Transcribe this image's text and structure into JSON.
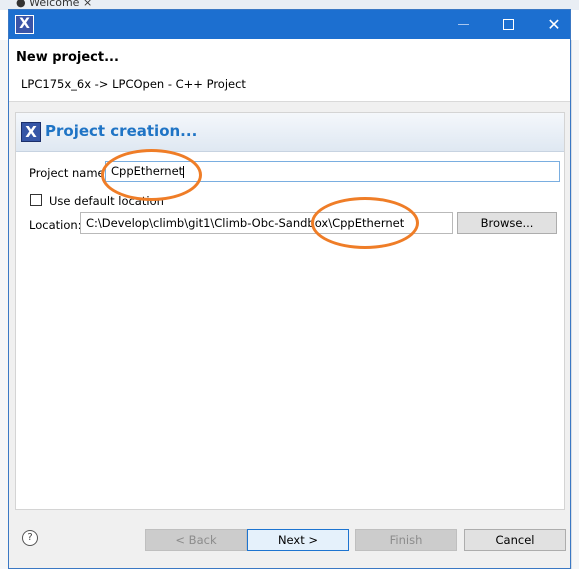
{
  "background": {
    "tab_label": "Welcome",
    "tab_close": "×"
  },
  "window": {
    "minimize_icon": "minimize-icon",
    "maximize_icon": "maximize-icon",
    "close_symbol": "✕"
  },
  "header": {
    "title": "New project...",
    "subtitle": "LPC175x_6x -> LPCOpen - C++ Project"
  },
  "section": {
    "title": "Project creation..."
  },
  "form": {
    "project_name_label": "Project name:",
    "project_name_value": "CppEthernet",
    "use_default_label": "Use default location",
    "use_default_checked": false,
    "location_label": "Location:",
    "location_value": "C:\\Develop\\climb\\git1\\Climb-Obc-Sandbox\\CppEthernet",
    "browse_label": "Browse..."
  },
  "footer": {
    "help_symbol": "?",
    "back_label": "< Back",
    "next_label": "Next >",
    "finish_label": "Finish",
    "cancel_label": "Cancel"
  },
  "colors": {
    "titlebar": "#1c6fd0",
    "section_title": "#1f74c5",
    "annotation": "#ef7d27"
  }
}
